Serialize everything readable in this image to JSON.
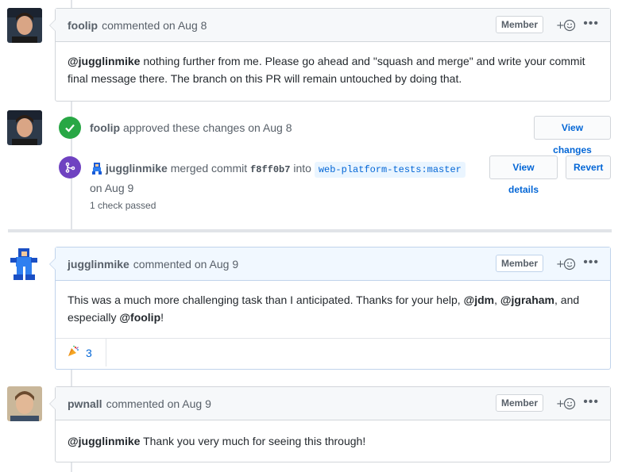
{
  "comments": [
    {
      "author": "foolip",
      "action": "commented on Aug 8",
      "badge": "Member",
      "body_mention": "@jugglinmike",
      "body_text": " nothing further from me. Please go ahead and \"squash and merge\" and write your commit final message there. The branch on this PR will remain untouched by doing that."
    },
    {
      "author": "jugglinmike",
      "action": "commented on Aug 9",
      "badge": "Member",
      "body_before": "This was a much more challenging task than I anticipated. Thanks for your help, ",
      "mention_1": "@jdm",
      "sep_1": ", ",
      "mention_2": "@jgraham",
      "sep_2": ", and especially ",
      "mention_3": "@foolip",
      "body_after": "!",
      "reaction_count": "3"
    },
    {
      "author": "pwnall",
      "action": "commented on Aug 9",
      "badge": "Member",
      "body_mention": "@jugglinmike",
      "body_text": " Thank you very much for seeing this through!"
    }
  ],
  "approval": {
    "author": "foolip",
    "text": "approved these changes on Aug 8",
    "button": "View changes"
  },
  "merge": {
    "author": "jugglinmike",
    "text": "merged commit",
    "sha": "f8ff0b7",
    "into": "into",
    "branch": "web-platform-tests:master",
    "date": "on Aug 9",
    "checks": "1 check passed",
    "details_button": "View details",
    "revert_button": "Revert"
  },
  "colors": {
    "approved_green": "#28a745",
    "merged_purple": "#6f42c1",
    "link_blue": "#0366d6"
  }
}
